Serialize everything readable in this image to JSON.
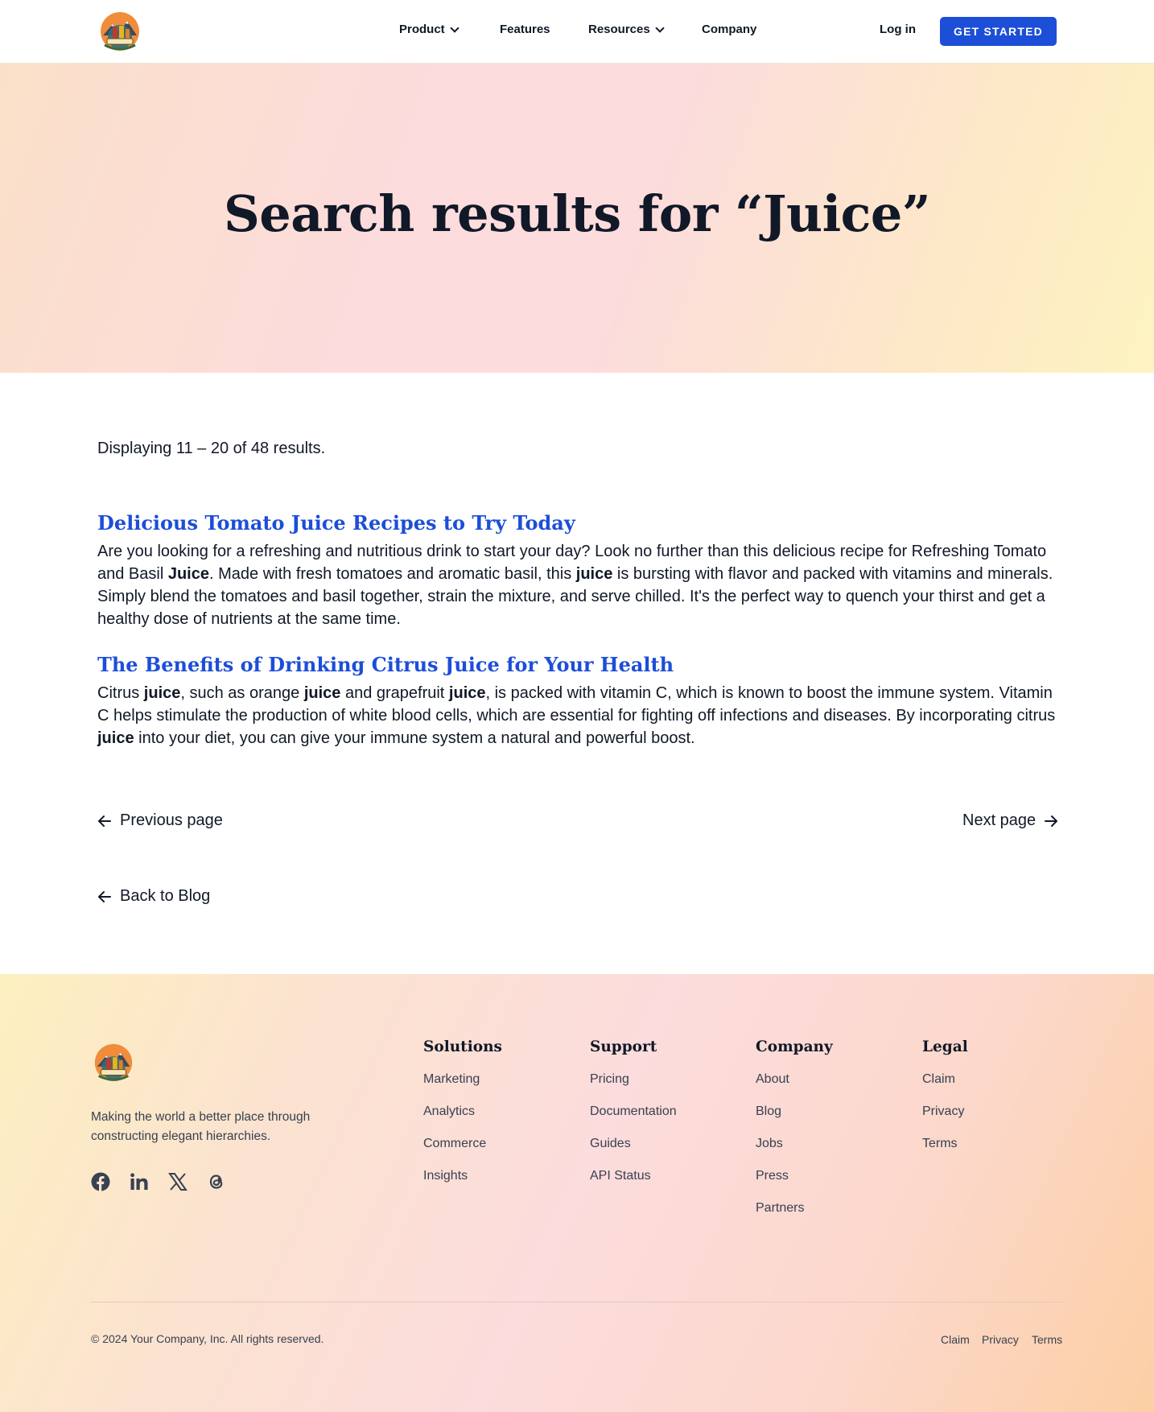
{
  "header": {
    "logo_alt": "logo",
    "nav": [
      {
        "label": "Product",
        "dropdown": true
      },
      {
        "label": "Features",
        "dropdown": false
      },
      {
        "label": "Resources",
        "dropdown": true
      },
      {
        "label": "Company",
        "dropdown": false
      }
    ],
    "login": "Log in",
    "cta": "GET STARTED"
  },
  "hero": {
    "title": "Search results for “Juice”"
  },
  "results": {
    "count_text": "Displaying 11 – 20 of 48 results.",
    "items": [
      {
        "title": "Delicious Tomato Juice Recipes to Try Today",
        "excerpt_parts": [
          {
            "text": "Are you looking for a refreshing and nutritious drink to start your day? Look no further than this delicious recipe for Refreshing Tomato and Basil ",
            "bold": false
          },
          {
            "text": "Juice",
            "bold": true
          },
          {
            "text": ". Made with fresh tomatoes and aromatic basil, this ",
            "bold": false
          },
          {
            "text": "juice",
            "bold": true
          },
          {
            "text": " is bursting with flavor and packed with vitamins and minerals. Simply blend the tomatoes and basil together, strain the mixture, and serve chilled. It's the perfect way to quench your thirst and get a healthy dose of nutrients at the same time.",
            "bold": false
          }
        ]
      },
      {
        "title": "The Benefits of Drinking Citrus Juice for Your Health",
        "excerpt_parts": [
          {
            "text": "Citrus ",
            "bold": false
          },
          {
            "text": "juice",
            "bold": true
          },
          {
            "text": ", such as orange ",
            "bold": false
          },
          {
            "text": "juice",
            "bold": true
          },
          {
            "text": " and grapefruit ",
            "bold": false
          },
          {
            "text": "juice",
            "bold": true
          },
          {
            "text": ", is packed with vitamin C, which is known to boost the immune system. Vitamin C helps stimulate the production of white blood cells, which are essential for fighting off infections and diseases. By incorporating citrus ",
            "bold": false
          },
          {
            "text": "juice",
            "bold": true
          },
          {
            "text": " into your diet, you can give your immune system a natural and powerful boost.",
            "bold": false
          }
        ]
      }
    ]
  },
  "pagination": {
    "previous": "Previous page",
    "next": "Next page",
    "back": "Back to Blog"
  },
  "footer": {
    "tagline": "Making the world a better place through constructing elegant hierarchies.",
    "socials": [
      "facebook-icon",
      "linkedin-icon",
      "x-icon",
      "threads-icon"
    ],
    "columns": [
      {
        "heading": "Solutions",
        "links": [
          "Marketing",
          "Analytics",
          "Commerce",
          "Insights"
        ]
      },
      {
        "heading": "Support",
        "links": [
          "Pricing",
          "Documentation",
          "Guides",
          "API Status"
        ]
      },
      {
        "heading": "Company",
        "links": [
          "About",
          "Blog",
          "Jobs",
          "Press",
          "Partners"
        ]
      },
      {
        "heading": "Legal",
        "links": [
          "Claim",
          "Privacy",
          "Terms"
        ]
      }
    ],
    "copyright": "© 2024 Your Company, Inc. All rights reserved.",
    "bottom_links": [
      "Claim",
      "Privacy",
      "Terms"
    ]
  },
  "colors": {
    "accent": "#1d4ed8",
    "text": "#111827",
    "muted": "#374151"
  }
}
